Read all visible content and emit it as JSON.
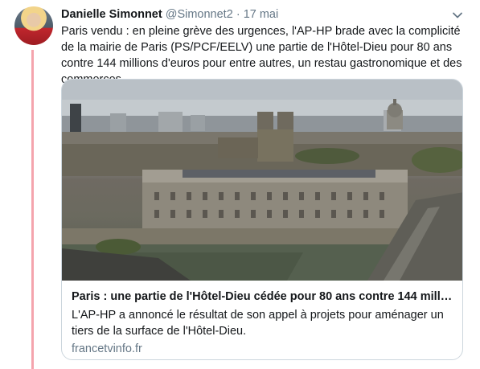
{
  "tweet": {
    "author_name": "Danielle Simonnet",
    "author_handle": "@Simonnet2",
    "separator": "·",
    "date": "17 mai",
    "text": "Paris vendu : en pleine grève des urgences, l'AP-HP brade avec la complicité de la mairie de Paris (PS/PCF/EELV) une partie de l'Hôtel-Dieu pour 80 ans contre 144 millions d'euros pour entre autres, un restau gastronomique et des commerces.",
    "more_icon": "chevron-down-icon"
  },
  "card": {
    "title": "Paris : une partie de l'Hôtel-Dieu cédée pour 80 ans contre 144 millio...",
    "description": "L'AP-HP a annoncé le résultat de son appel à projets pour aménager un tiers de la surface de l'Hôtel-Dieu.",
    "domain": "francetvinfo.fr"
  },
  "colors": {
    "thread_line": "#f4a4ad",
    "secondary_text": "#657786",
    "border": "#ccd6dd"
  }
}
